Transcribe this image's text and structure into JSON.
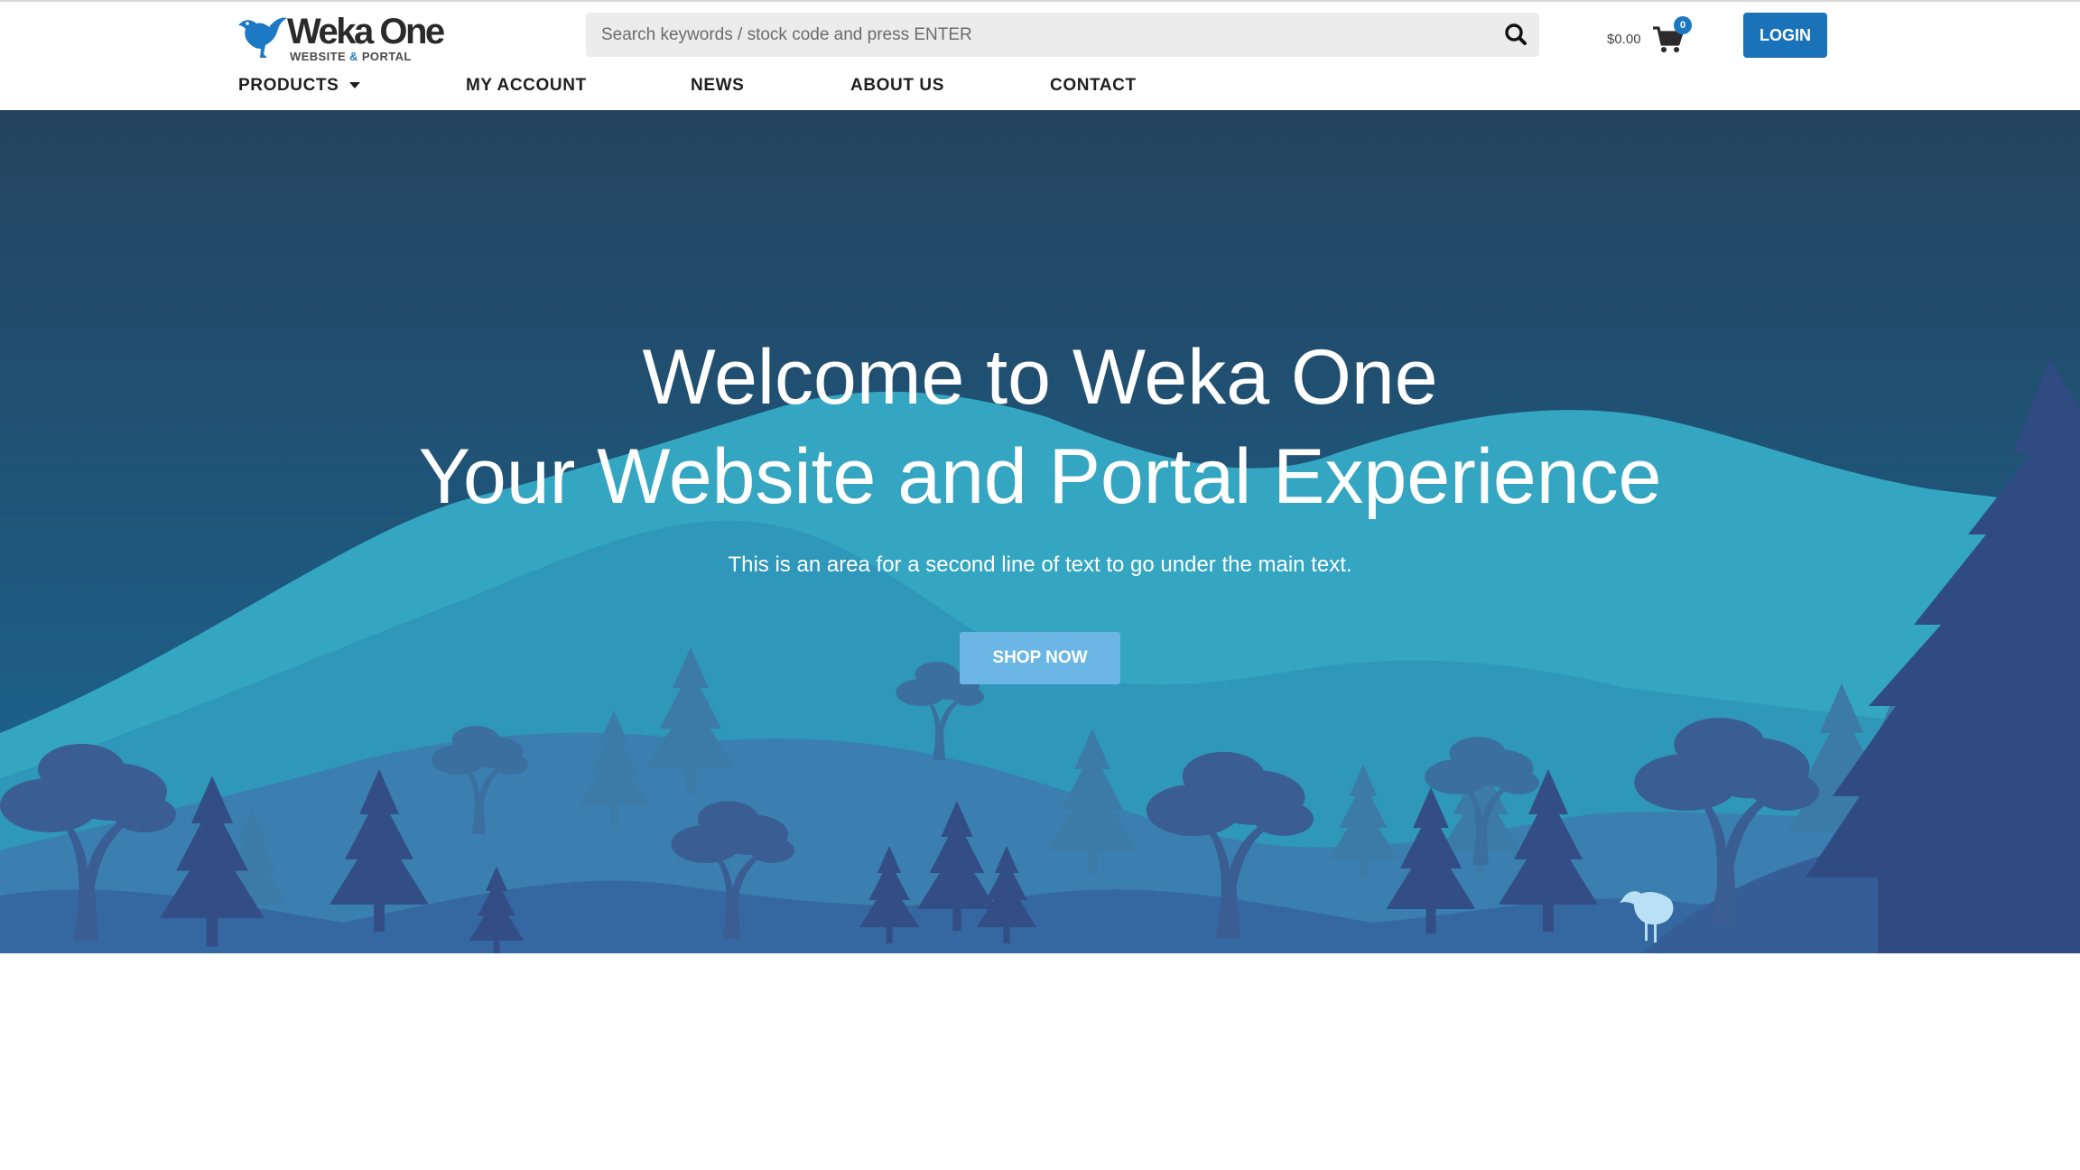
{
  "brand": {
    "name": "Weka One",
    "tagline_part1": "WEBSITE",
    "tagline_amp": "&",
    "tagline_part2": "PORTAL",
    "accent_color": "#1a72b9",
    "icon": "weka-bird-logo"
  },
  "search": {
    "placeholder": "Search keywords / stock code and press ENTER",
    "value": "",
    "icon": "search-icon"
  },
  "cart": {
    "total": "$0.00",
    "count": "0",
    "icon": "shopping-cart-icon"
  },
  "header": {
    "login_label": "LOGIN"
  },
  "nav": {
    "items": [
      {
        "label": "PRODUCTS",
        "has_dropdown": true
      },
      {
        "label": "MY ACCOUNT"
      },
      {
        "label": "NEWS"
      },
      {
        "label": "ABOUT US"
      },
      {
        "label": "CONTACT"
      }
    ]
  },
  "hero": {
    "title_line1": "Welcome to Weka One",
    "title_line2": "Your Website and Portal Experience",
    "subtitle": "This is an area for a second line of text to go under the main text.",
    "cta_label": "SHOP NOW",
    "cta_color": "#6cb6e6",
    "background": "forest-mountain-illustration"
  }
}
